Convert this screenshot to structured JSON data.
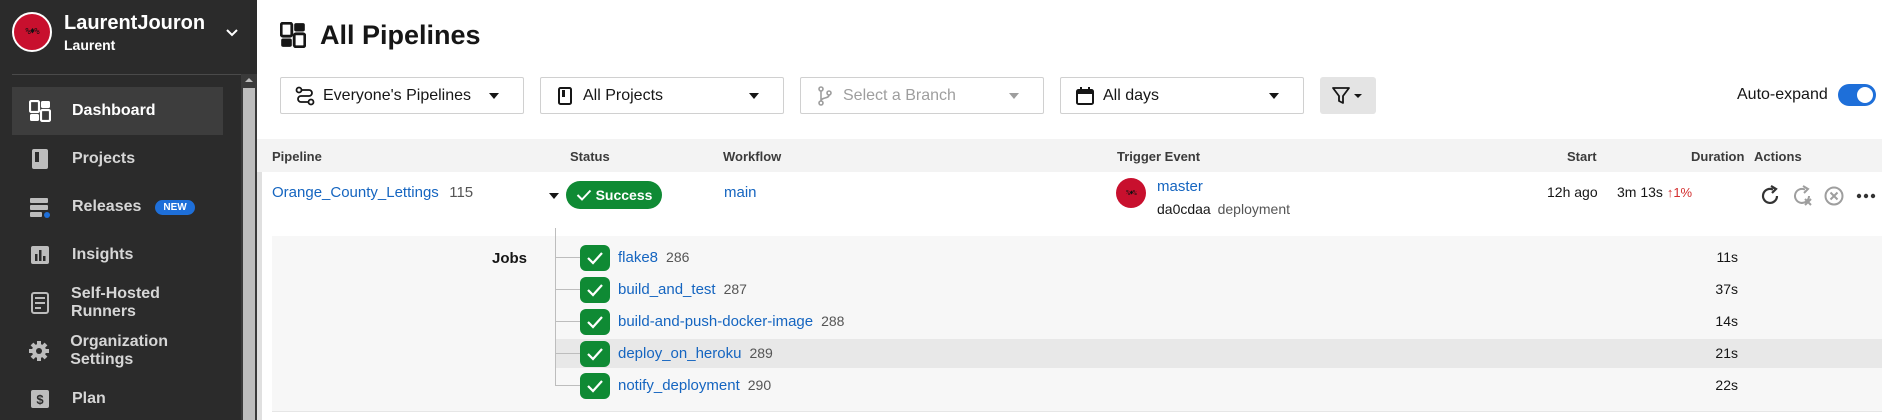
{
  "org": {
    "name": "LaurentJouron",
    "user": "Laurent",
    "avatar_text": "%♦%"
  },
  "sidebar": {
    "items": [
      {
        "label": "Dashboard",
        "icon": "dashboard-icon"
      },
      {
        "label": "Projects",
        "icon": "projects-icon"
      },
      {
        "label": "Releases",
        "icon": "releases-icon",
        "badge": "NEW"
      },
      {
        "label": "Insights",
        "icon": "insights-icon"
      },
      {
        "label": "Self-Hosted Runners",
        "icon": "runners-icon"
      },
      {
        "label": "Organization Settings",
        "icon": "gear-icon"
      },
      {
        "label": "Plan",
        "icon": "plan-icon"
      }
    ]
  },
  "header": {
    "title": "All Pipelines"
  },
  "filters": {
    "pipelines": "Everyone's Pipelines",
    "projects": "All Projects",
    "branch_placeholder": "Select a Branch",
    "days": "All days",
    "autoexpand_label": "Auto-expand"
  },
  "table": {
    "columns": [
      "Pipeline",
      "Status",
      "Workflow",
      "Trigger Event",
      "Start",
      "Duration",
      "Actions"
    ],
    "pipeline": {
      "name": "Orange_County_Lettings",
      "number": "115",
      "status": "Success",
      "workflow": "main",
      "trigger_branch": "master",
      "trigger_commit": "da0cdaa",
      "trigger_message": "deployment",
      "start": "12h ago",
      "duration": "3m 13s",
      "duration_delta": "1%"
    },
    "jobs_label": "Jobs",
    "jobs": [
      {
        "name": "flake8",
        "number": "286",
        "duration": "11s"
      },
      {
        "name": "build_and_test",
        "number": "287",
        "duration": "37s"
      },
      {
        "name": "build-and-push-docker-image",
        "number": "288",
        "duration": "14s"
      },
      {
        "name": "deploy_on_heroku",
        "number": "289",
        "duration": "21s"
      },
      {
        "name": "notify_deployment",
        "number": "290",
        "duration": "22s"
      }
    ]
  },
  "colors": {
    "success": "#0f8a34",
    "link": "#1565c0",
    "accent": "#1e6fd9",
    "sidebar": "#2b2b2b"
  }
}
